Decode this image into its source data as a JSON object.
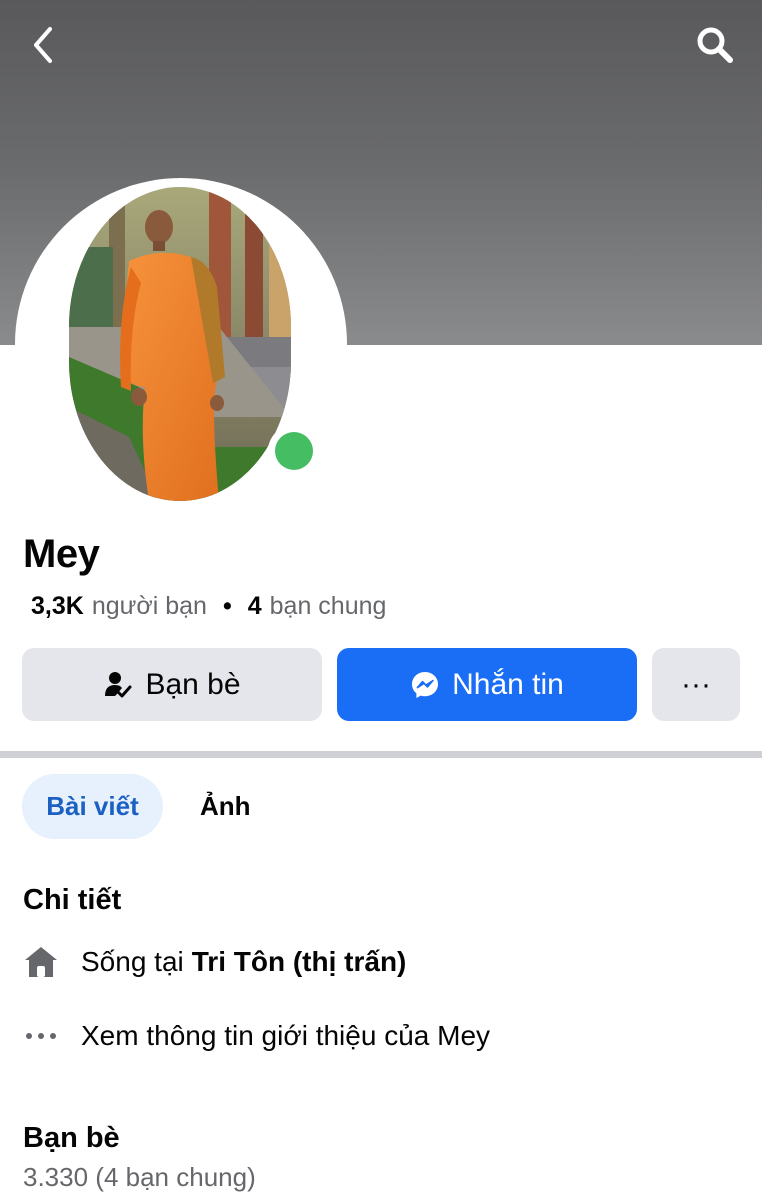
{
  "header": {
    "back_icon": "chevron-left-icon",
    "search_icon": "search-icon"
  },
  "profile": {
    "name": "Mey",
    "friends_count": "3,3K",
    "friends_label": "người bạn",
    "mutual_count": "4",
    "mutual_label": "bạn chung",
    "online": true,
    "online_color": "#45bd62"
  },
  "actions": {
    "friends_label": "Bạn bè",
    "message_label": "Nhắn tin",
    "more_label": "···",
    "accent_color": "#1a6ef5"
  },
  "tabs": [
    {
      "label": "Bài viết",
      "active": true
    },
    {
      "label": "Ảnh",
      "active": false
    }
  ],
  "details": {
    "title": "Chi tiết",
    "lives_in_prefix": "Sống tại",
    "lives_in_place": "Tri Tôn (thị trấn)",
    "see_about": "Xem thông tin giới thiệu của Mey"
  },
  "friends_section": {
    "title": "Bạn bè",
    "count_text": "3.330 (4 bạn chung)"
  }
}
